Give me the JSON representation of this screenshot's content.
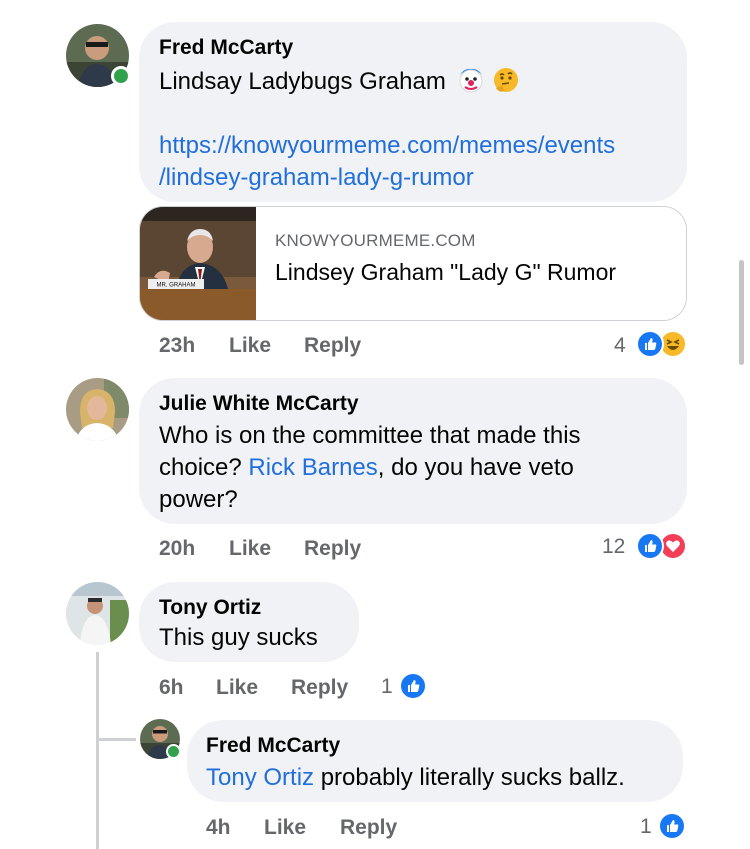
{
  "comments": [
    {
      "author": "Fred McCarty",
      "text": "Lindsay Ladybugs Graham",
      "link_line1": "https://knowyourmeme.com/memes/events",
      "link_line2": "/lindsey-graham-lady-g-rumor",
      "preview": {
        "domain": "KNOWYOURMEME.COM",
        "title": "Lindsey Graham \"Lady G\" Rumor",
        "thumb_caption": "MR. GRAHAM"
      },
      "time": "23h",
      "like_label": "Like",
      "reply_label": "Reply",
      "reaction_count": "4",
      "reactions": [
        "like-icon",
        "haha-icon"
      ],
      "emojis": [
        "clown-emoji",
        "thinking-emoji"
      ]
    },
    {
      "author": "Julie White McCarty",
      "text_line1": "Who is on the committee that made this",
      "text_line2_pre": "choice? ",
      "mention": "Rick Barnes",
      "text_line2_post": ", do you have veto",
      "text_line3": "power?",
      "time": "20h",
      "like_label": "Like",
      "reply_label": "Reply",
      "reaction_count": "12",
      "reactions": [
        "like-icon",
        "love-icon"
      ]
    },
    {
      "author": "Tony Ortiz",
      "text": "This guy sucks",
      "time": "6h",
      "like_label": "Like",
      "reply_label": "Reply",
      "reaction_count": "1",
      "reactions": [
        "like-icon"
      ]
    },
    {
      "author": "Fred McCarty",
      "mention": "Tony Ortiz",
      "text": " probably literally sucks ballz.",
      "time": "4h",
      "like_label": "Like",
      "reply_label": "Reply",
      "reaction_count": "1",
      "reactions": [
        "like-icon"
      ]
    }
  ],
  "colors": {
    "bubble": "#f0f2f5",
    "link": "#216fdb",
    "like": "#1877f2",
    "love": "#f33e58",
    "haha": "#f7b928",
    "online": "#31a24c",
    "meta": "#65676b"
  }
}
